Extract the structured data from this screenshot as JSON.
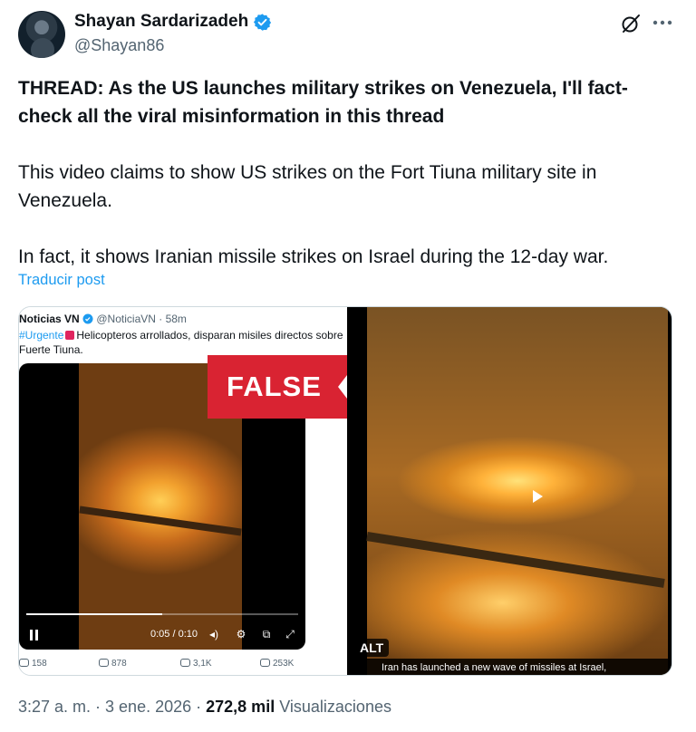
{
  "author": {
    "name": "Shayan Sardarizadeh",
    "handle": "@Shayan86",
    "verified": true
  },
  "tweet": {
    "paragraphs": [
      "THREAD: As the US launches military strikes on Venezuela, I'll fact-check all the viral misinformation in this thread",
      "This video claims to show US strikes on the Fort Tiuna military site in Venezuela.",
      "In fact, it shows Iranian missile strikes on Israel during the 12-day war."
    ],
    "translate_label": "Traducir post"
  },
  "media": {
    "embed": {
      "name": "Noticias VN",
      "handle_time": "@NoticiaVN · 58m",
      "hashtag": "#Urgente",
      "text": "Helicopteros arrollados, disparan misiles directos sobre Fuerte Tiuna.",
      "false_label": "FALSE",
      "video_time": "0:05 / 0:10",
      "video_progress_fraction": 0.5,
      "stats": {
        "replies": "158",
        "reposts": "878",
        "likes": "3,1K",
        "views": "253K"
      }
    },
    "video": {
      "alt_badge": "ALT",
      "caption": "Iran has launched a new wave of missiles at Israel,"
    }
  },
  "footer": {
    "time_date": "3:27 a. m. · 3 ene. 2026 ·",
    "views_count": "272,8 mil",
    "views_label": "Visualizaciones"
  },
  "icons": {
    "verified": "verified-badge-icon",
    "grok": "grok-icon",
    "more": "more-options-icon"
  },
  "colors": {
    "link": "#1d9bf0",
    "verified": "#1d9bf0",
    "false_banner": "#d92332"
  }
}
